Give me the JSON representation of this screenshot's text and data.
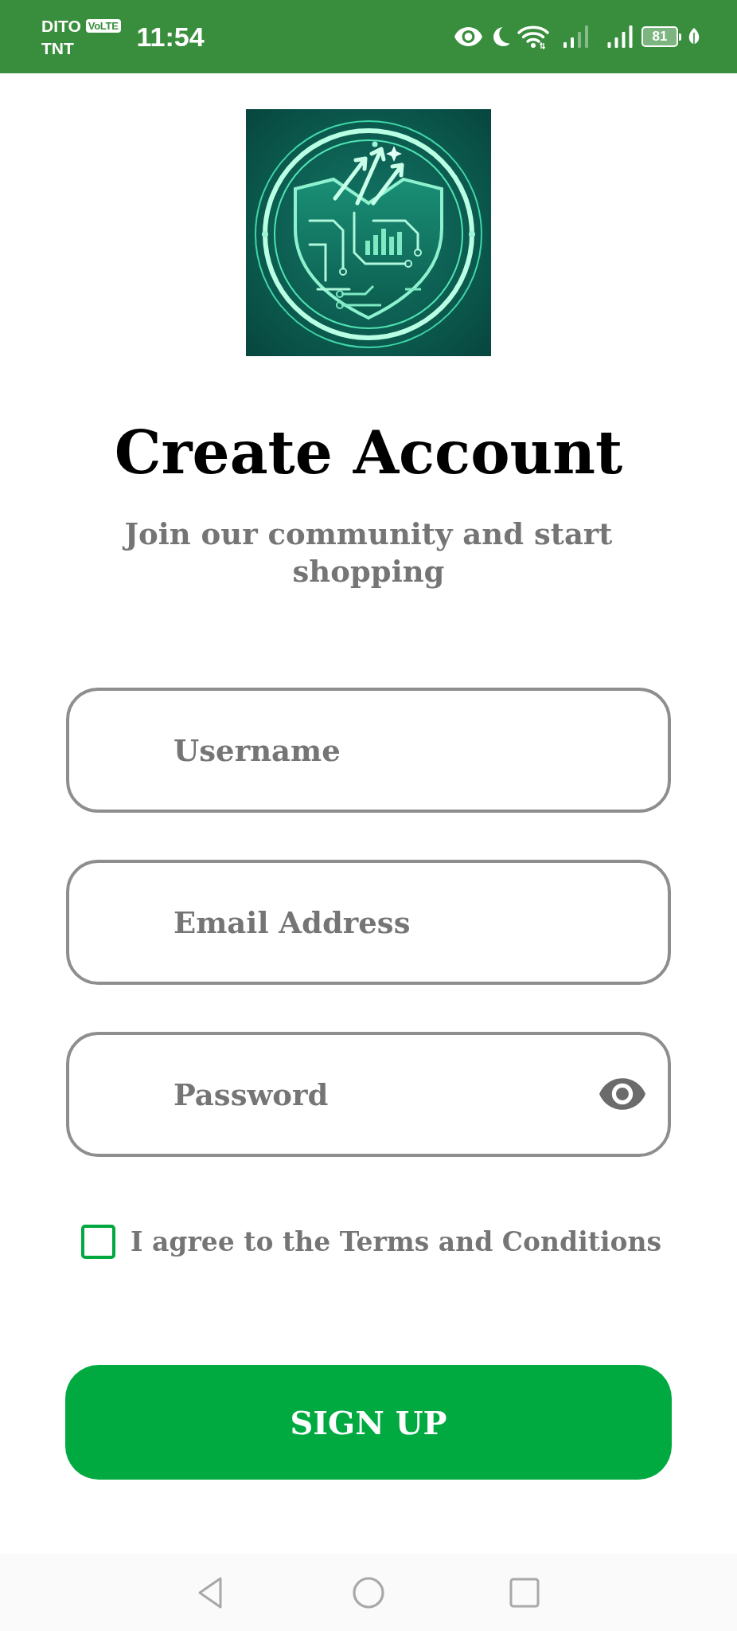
{
  "status_bar": {
    "carrier_primary": "DITO",
    "network_badge": "VoLTE",
    "carrier_secondary": "TNT",
    "time": "11:54",
    "battery": "81"
  },
  "header": {
    "title": "Create Account",
    "subtitle": "Join our community and start shopping"
  },
  "form": {
    "fields": [
      {
        "kind": "text",
        "placeholder": "Username"
      },
      {
        "kind": "email",
        "placeholder": "Email Address"
      },
      {
        "kind": "password",
        "placeholder": "Password"
      }
    ],
    "terms": {
      "label": "I agree to the Terms and Conditions",
      "checked": false
    },
    "submit": {
      "label": "SIGN UP"
    }
  }
}
